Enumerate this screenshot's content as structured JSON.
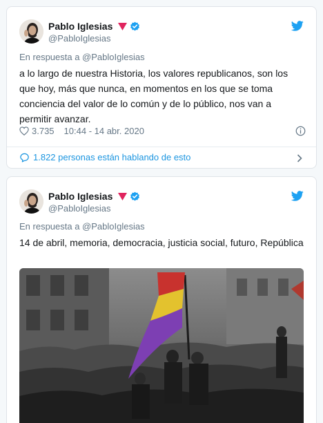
{
  "tweets": [
    {
      "user": {
        "name": "Pablo Iglesias",
        "handle": "@PabloIglesias"
      },
      "reply_to": "En respuesta a @PabloIglesias",
      "text": "a lo largo de nuestra Historia, los valores republicanos, son los que hoy, más que nunca, en momentos en los que se toma conciencia del valor de lo común y de lo público, nos van a permitir avanzar.",
      "likes": "3.735",
      "timestamp": "10:44 - 14 abr. 2020",
      "conversation": "1.822 personas están hablando de esto"
    },
    {
      "user": {
        "name": "Pablo Iglesias",
        "handle": "@PabloIglesias"
      },
      "reply_to": "En respuesta a @PabloIglesias",
      "text": "14 de abril, memoria, democracia, justicia social, futuro, República"
    }
  ],
  "colors": {
    "accent": "#1da1f2",
    "link": "#1b95e0",
    "rose": "#e0245e",
    "muted": "#657786"
  },
  "icons": [
    "avatar",
    "rose-icon",
    "verified-icon",
    "twitter-bird-icon",
    "heart-icon",
    "info-icon",
    "speech-bubble-icon",
    "chevron-right-icon"
  ]
}
